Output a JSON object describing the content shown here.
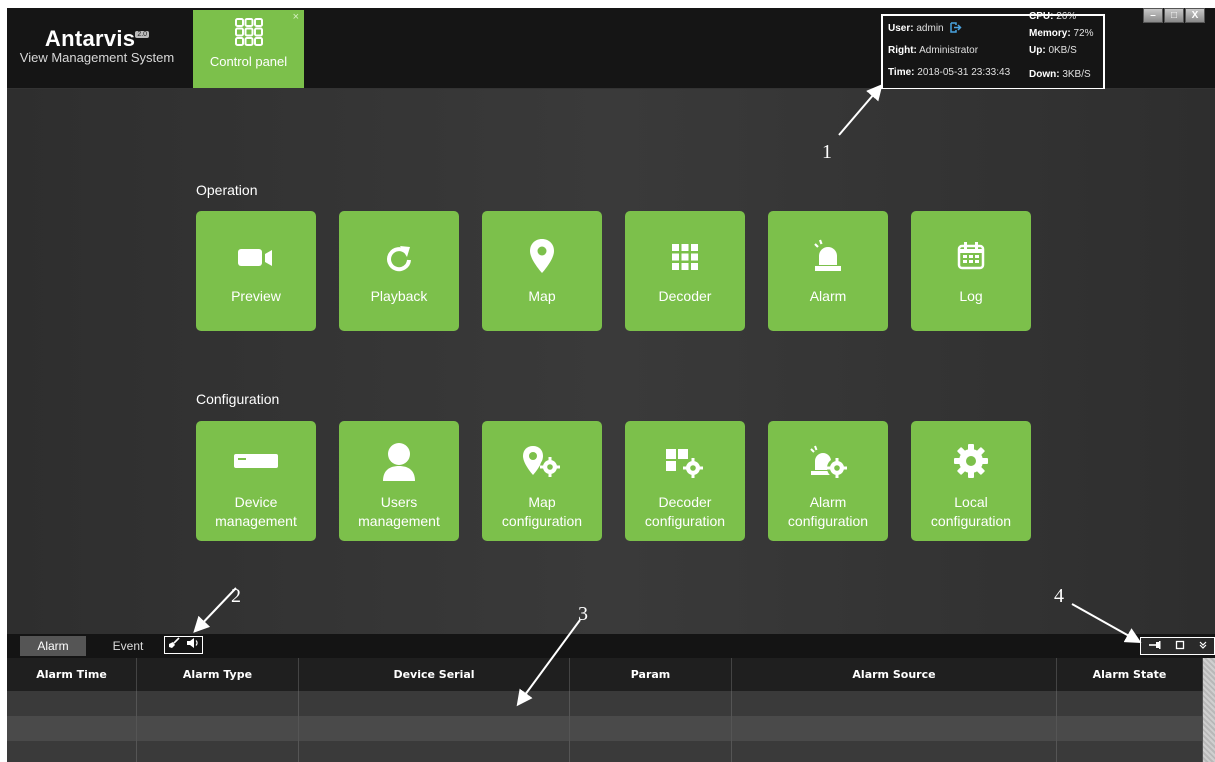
{
  "header": {
    "brand": "Antarvis",
    "brand_badge": "2.0",
    "subtitle": "View Management System",
    "active_tab": {
      "label": "Control panel",
      "close_symbol": "×"
    }
  },
  "status": {
    "user_label": "User:",
    "user_value": "admin",
    "right_label": "Right:",
    "right_value": "Administrator",
    "time_label": "Time:",
    "time_value": "2018-05-31 23:33:43",
    "cpu_label": "CPU:",
    "cpu_value": "26%",
    "memory_label": "Memory:",
    "memory_value": "72%",
    "up_label": "Up:",
    "up_value": "0KB/S",
    "down_label": "Down:",
    "down_value": "3KB/S"
  },
  "window_controls": {
    "minimize": "–",
    "maximize": "□",
    "close": "X"
  },
  "operation": {
    "title": "Operation",
    "tiles": [
      {
        "label": "Preview",
        "icon": "camera-icon"
      },
      {
        "label": "Playback",
        "icon": "refresh-icon"
      },
      {
        "label": "Map",
        "icon": "map-pin-icon"
      },
      {
        "label": "Decoder",
        "icon": "grid-icon"
      },
      {
        "label": "Alarm",
        "icon": "siren-icon"
      },
      {
        "label": "Log",
        "icon": "calendar-icon"
      }
    ]
  },
  "configuration": {
    "title": "Configuration",
    "tiles": [
      {
        "line1": "Device",
        "line2": "management",
        "icon": "device-icon"
      },
      {
        "line1": "Users",
        "line2": "management",
        "icon": "user-icon"
      },
      {
        "line1": "Map",
        "line2": "configuration",
        "icon": "map-gear-icon"
      },
      {
        "line1": "Decoder",
        "line2": "configuration",
        "icon": "decoder-gear-icon"
      },
      {
        "line1": "Alarm",
        "line2": "configuration",
        "icon": "alarm-gear-icon"
      },
      {
        "line1": "Local",
        "line2": "configuration",
        "icon": "gear-icon"
      }
    ]
  },
  "annotations": [
    "1",
    "2",
    "3",
    "4"
  ],
  "bottom_tabs": [
    "Alarm",
    "Event"
  ],
  "table": {
    "columns": [
      "Alarm Time",
      "Alarm Type",
      "Device Serial",
      "Param",
      "Alarm Source",
      "Alarm State"
    ]
  },
  "colors": {
    "accent": "#7cc04b",
    "background": "#2b2b2b",
    "header": "#151515"
  }
}
